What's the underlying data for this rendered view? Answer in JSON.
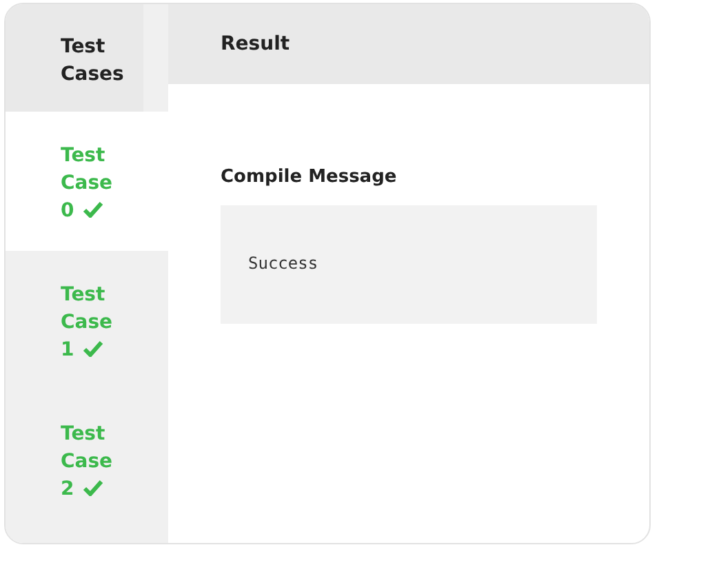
{
  "sidebar": {
    "heading": "Test Cases",
    "items": [
      {
        "label": "Test Case 0",
        "passed": true,
        "selected": true
      },
      {
        "label": "Test Case 1",
        "passed": true,
        "selected": false
      },
      {
        "label": "Test Case 2",
        "passed": true,
        "selected": false
      }
    ]
  },
  "result": {
    "heading": "Result",
    "section_title": "Compile Message",
    "message": "Success"
  }
}
